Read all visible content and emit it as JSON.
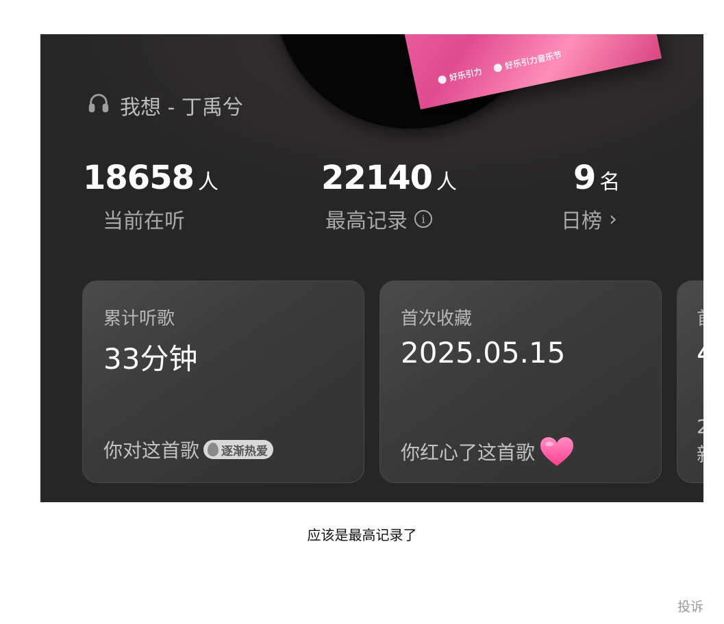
{
  "track": {
    "title": "我想 - 丁禹兮",
    "icon": "headphones-icon"
  },
  "stats": {
    "listening": {
      "value": "18658",
      "unit": "人",
      "label": "当前在听"
    },
    "record": {
      "value": "22140",
      "unit": "人",
      "label": "最高记录",
      "icon": "info-icon",
      "icon_glyph": "i"
    },
    "daily_rank": {
      "value": "9",
      "unit": "名",
      "label": "日榜",
      "icon": "chevron-right-icon",
      "icon_glyph": "›"
    }
  },
  "cards": {
    "total_listen": {
      "label": "累计听歌",
      "value": "33分钟",
      "footer": "你对这首歌",
      "badge": "逐渐热爱"
    },
    "first_favorite": {
      "label": "首次收藏",
      "value": "2025.05.15",
      "footer": "你红心了这首歌",
      "icon": "heart-icon"
    },
    "third_partial": {
      "label": "首",
      "value": "4",
      "footer_line1": "2",
      "footer_line2": "新"
    }
  },
  "poster": {
    "brand_a": "好乐引力",
    "brand_b": "好乐引力音乐节"
  },
  "caption": "应该是最高记录了",
  "report_link": "投诉",
  "colors": {
    "panel_bg": "#262626",
    "card_bg": "#3a3a3a",
    "badge_bg": "#d9d9d9",
    "heart": "#ff4f9a"
  }
}
